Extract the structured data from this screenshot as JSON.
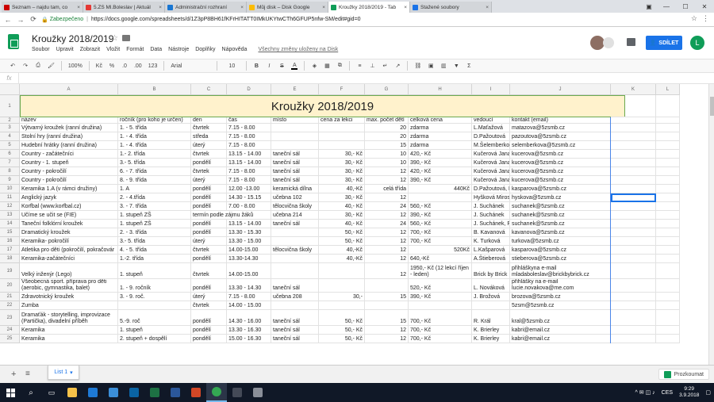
{
  "browser": {
    "tabs": [
      {
        "title": "Seznam – najdu tam, co",
        "color": "#cc0000",
        "active": false
      },
      {
        "title": "5.ZŠ Ml.Boleslav | Aktuál",
        "color": "#e53935",
        "active": false
      },
      {
        "title": "Administrační rozhraní",
        "color": "#1976d2",
        "active": false
      },
      {
        "title": "Můj disk – Disk Google",
        "color": "#fbbc04",
        "active": false
      },
      {
        "title": "Kroužky 2018/2019 - Tab",
        "color": "#0f9d58",
        "active": true
      },
      {
        "title": "Stažené soubory",
        "color": "#1a73e8",
        "active": false
      }
    ],
    "tab_close": "×",
    "window_user": "▣",
    "minimize": "—",
    "maximize": "☐",
    "close": "✕",
    "secure_label": "Zabezpečeno",
    "url": "https://docs.google.com/spreadsheets/d/1Z3pP8BH61fKFrHITATT0IMkUKYtwCTh6GFUP5nfw-SM/edit#gid=0",
    "back": "←",
    "forward": "→",
    "reload": "⟳",
    "star": "☆",
    "menu": "⋮"
  },
  "doc": {
    "title": "Kroužky 2018/2019",
    "star": "☆",
    "menu": [
      "Soubor",
      "Upravit",
      "Zobrazit",
      "Vložit",
      "Formát",
      "Data",
      "Nástroje",
      "Doplňky",
      "Nápověda"
    ],
    "save_state": "Všechny změny uloženy na Disk",
    "share_label": "SDÍLET",
    "share_icon": "👤",
    "user_initial": "L"
  },
  "toolbar": {
    "undo": "↶",
    "redo": "↷",
    "print": "⎙",
    "paint": "🖌",
    "zoom": "100%",
    "currency": "Kč",
    "percent": "%",
    "dec_less": ".0",
    "dec_more": ".00",
    "numfmt": "123",
    "font": "Arial",
    "size": "10",
    "bold": "B",
    "italic": "I",
    "strike": "S",
    "color": "A",
    "fill": "◈",
    "borders": "▦",
    "merge": "⧉",
    "halign": "≡",
    "valign": "⊥",
    "wrap": "↵",
    "rotate": "↗",
    "link": "⛓",
    "comment": "▣",
    "chart": "▥",
    "filter": "▼",
    "sum": "Σ"
  },
  "formula": {
    "fx": "fx",
    "value": ""
  },
  "columns": [
    "A",
    "B",
    "C",
    "D",
    "E",
    "F",
    "G",
    "H",
    "I",
    "J",
    "K",
    "L"
  ],
  "sheet_title": "Kroužky 2018/2019",
  "header": [
    "název",
    "ročník (pro koho je určen)",
    "den",
    "čas",
    "místo",
    "cena za lekci",
    "max. počet dětí",
    "celková cena",
    "vedoucí",
    "kontakt (email)"
  ],
  "rows": [
    {
      "n": "3",
      "c": [
        "Výtvarný kroužek (ranní družina)",
        "1. - 5. třída",
        "čtvrtek",
        "7.15 - 8.00",
        "",
        "",
        "20",
        "zdarma",
        "L.Maťažová",
        "matazova@5zsmb.cz"
      ]
    },
    {
      "n": "4",
      "c": [
        "Stolní hry (ranní družina)",
        "1. - 4. třída",
        "středa",
        "7.15 - 8.00",
        "",
        "",
        "20",
        "zdarma",
        "D.Pažoutová",
        "pazoutova@5zsmb.cz"
      ]
    },
    {
      "n": "5",
      "c": [
        "Hudební hrátky (ranní družina)",
        "1. - 4. třída",
        "úterý",
        "7.15 - 8.00",
        "",
        "",
        "15",
        "zdarma",
        "M.Šelemberková",
        "selemberkova@5zsmb.cz"
      ]
    },
    {
      "n": "6",
      "c": [
        "Country - začátečníci",
        "1.- 2. třída",
        "čtvrtek",
        "13.15 - 14.00",
        "taneční sál",
        "30,- Kč",
        "10",
        "420,- Kč",
        "Kučerová Jana",
        "kucerova@5zsmb.cz"
      ]
    },
    {
      "n": "7",
      "c": [
        "Country - 1. stupeň",
        "3.- 5. třída",
        "pondělí",
        "13.15 - 14.00",
        "taneční sál",
        "30,- Kč",
        "10",
        "390,- Kč",
        "Kučerová Jana",
        "kucerova@5zsmb.cz"
      ]
    },
    {
      "n": "8",
      "c": [
        "Country - pokročilí",
        "6. - 7. třída",
        "čtvrtek",
        "7.15 - 8.00",
        "taneční sál",
        "30,- Kč",
        "12",
        "420,- Kč",
        "Kučerová Jana",
        "kucerova@5zsmb.cz"
      ]
    },
    {
      "n": "9",
      "c": [
        "Country - pokročilí",
        "8. - 9. třída",
        "úterý",
        "7.15 - 8.00",
        "taneční sál",
        "30,- Kč",
        "12",
        "390,- Kč",
        "Kučerová Jana",
        "kucerova@5zsmb.cz"
      ]
    },
    {
      "n": "10",
      "c": [
        "Keramika 1.A (v rámci družiny)",
        "1. A",
        "pondělí",
        "12.00 -13.00",
        "keramická dílna",
        "40,-Kč",
        "celá třída",
        "440Kč",
        "D.Pažoutová, L. Kašpa",
        "kasparova@5zsmb.cz"
      ]
    },
    {
      "n": "11",
      "c": [
        "Anglický jazyk",
        "2. - 4.třída",
        "pondělí",
        "14.30 - 15.15",
        "učebna 102",
        "30,- Kč",
        "12",
        "",
        "Hyšková Miroslava",
        "hyskova@5zsmb.cz"
      ]
    },
    {
      "n": "12",
      "c": [
        "Korfbal (www.korfbal.cz)",
        "3. - 7. třída",
        "pondělí",
        "7.00 - 8.00",
        "tělocvična školy",
        "40,- Kč",
        "24",
        "560,- Kč",
        "J. Suchánek",
        "suchanek@5zsmb.cz"
      ]
    },
    {
      "n": "13",
      "c": [
        "Učíme se učit se (FIE)",
        "1. stupeň ZŠ",
        "termín podle zájmu žáků",
        "",
        "učebna 214",
        "30,- Kč",
        "12",
        "390,- Kč",
        "J. Suchánek",
        "suchanek@5zsmb.cz"
      ]
    },
    {
      "n": "14",
      "c": [
        "Taneční folklórní kroužek",
        "1. stupeň ZŠ",
        "pondělí",
        "13.15 - 14.00",
        "taneční sál",
        "40,- Kč",
        "24",
        "560,- Kč",
        "J. Suchánek, P. Hurt",
        "suchanek@5zsmb.cz"
      ]
    },
    {
      "n": "15",
      "c": [
        "Dramatický kroužek",
        "2. - 3. třída",
        "pondělí",
        "13.30 - 15.30",
        "",
        "50,- Kč",
        "12",
        "700,- Kč",
        "B. Kavanová",
        "kavanova@5zsmb.cz"
      ]
    },
    {
      "n": "16",
      "c": [
        "Keramika- pokročilí",
        "3.- 5. třída",
        "úterý",
        "13.30 - 15.00",
        "",
        "50,- Kč",
        "12",
        "700,- Kč",
        "K. Turková",
        "turkova@5zsmb.cz"
      ]
    },
    {
      "n": "17",
      "c": [
        "Atletika pro děti (pokročilí, pokračovár",
        "4. - 5. třída",
        "čtvrtek",
        "14.00-15.00",
        "tělocvična školy",
        "40,-Kč",
        "12",
        "520Kč",
        "L.Kašparová",
        "kasparova@5zsmb.cz"
      ]
    },
    {
      "n": "18",
      "c": [
        "Keramika-začátečníci",
        "1.-2. třída",
        "pondělí",
        "13.30-14.30",
        "",
        "40,-Kč",
        "12",
        "640,-Kč",
        "A.Štieberová",
        "stieberova@5zsmb.cz"
      ]
    },
    {
      "n": "19",
      "c": [
        "Velký inženýr (Lego)",
        "1. stupeň",
        "čtvrtek",
        "14.00-15.00",
        "",
        "",
        "12",
        "1950,- Kč (12 lekcí říjen - leden)",
        "Brick by Brick",
        "přihláškyna e-mail mladaboleslav@brickbybrick.cz"
      ]
    },
    {
      "n": "20",
      "c": [
        "Všeobecná sport. příprava pro děti (aerobic, gymnastika, balet)",
        "1. - 9. ročník",
        "pondělí",
        "13.30 - 14.30",
        "taneční sál",
        "",
        "",
        "520,- Kč",
        "L. Nováková",
        "přihlášky na e-mail lucie.novakova@me.com"
      ]
    },
    {
      "n": "21",
      "c": [
        "Zdravotnický kroužek",
        "3. - 9. roč.",
        "úterý",
        "7.15 - 8.00",
        "učebna 208",
        "30,-",
        "15",
        "390,- Kč",
        "J. Brožová",
        "brozova@5zsmb.cz"
      ]
    },
    {
      "n": "22",
      "c": [
        "Zumba",
        "",
        "čtvrtek",
        "14.00 - 15.00",
        "",
        "",
        "",
        "",
        "",
        "5zsm@5zsmb.cz"
      ]
    },
    {
      "n": "23",
      "c": [
        "Dramaťák - storytelling, improvizace (Partička), divadelní příběh",
        "5.-9. roč",
        "pondělí",
        "14.30 - 16.00",
        "taneční sál",
        "50,- Kč",
        "15",
        "700,- Kč",
        "R. Král",
        "kral@5zsmb.cz"
      ]
    },
    {
      "n": "24",
      "c": [
        "Keramika",
        "1. stupeň",
        "pondělí",
        "13.30 - 16.30",
        "taneční sál",
        "50,- Kč",
        "12",
        "700,- Kč",
        "K. Brierley",
        "kabri@email.cz"
      ]
    },
    {
      "n": "25",
      "c": [
        "Keramika",
        "2. stupeň + dospělí",
        "pondělí",
        "15.00 - 16.30",
        "taneční sál",
        "50,- Kč",
        "12",
        "700,- Kč",
        "K. Brierley",
        "kabri@email.cz"
      ]
    }
  ],
  "sheets": {
    "add": "+",
    "all": "≡",
    "tab": "List 1",
    "tab_arrow": "▾",
    "explore": "Prozkoumat"
  },
  "taskbar": {
    "search": "⌕",
    "taskview": "▭",
    "lang": "CES",
    "time": "9:29",
    "date": "3.9.2018",
    "tray_icons": "^ ✉ ◫ ♪",
    "notify": "▢",
    "apps": [
      {
        "name": "explorer-app",
        "color": "#f6c24a"
      },
      {
        "name": "edge-app",
        "color": "#1e7ad6"
      },
      {
        "name": "ie-app",
        "color": "#3b8fd9"
      },
      {
        "name": "mail-app",
        "color": "#0a64a4"
      },
      {
        "name": "excel-app",
        "color": "#1d7144"
      },
      {
        "name": "word-app",
        "color": "#2b579a"
      },
      {
        "name": "powerpoint-app",
        "color": "#d24726"
      },
      {
        "name": "chrome-app",
        "color": "#34a853"
      },
      {
        "name": "calculator-app",
        "color": "#444a57"
      },
      {
        "name": "paint-app",
        "color": "#8a8f99"
      }
    ]
  }
}
